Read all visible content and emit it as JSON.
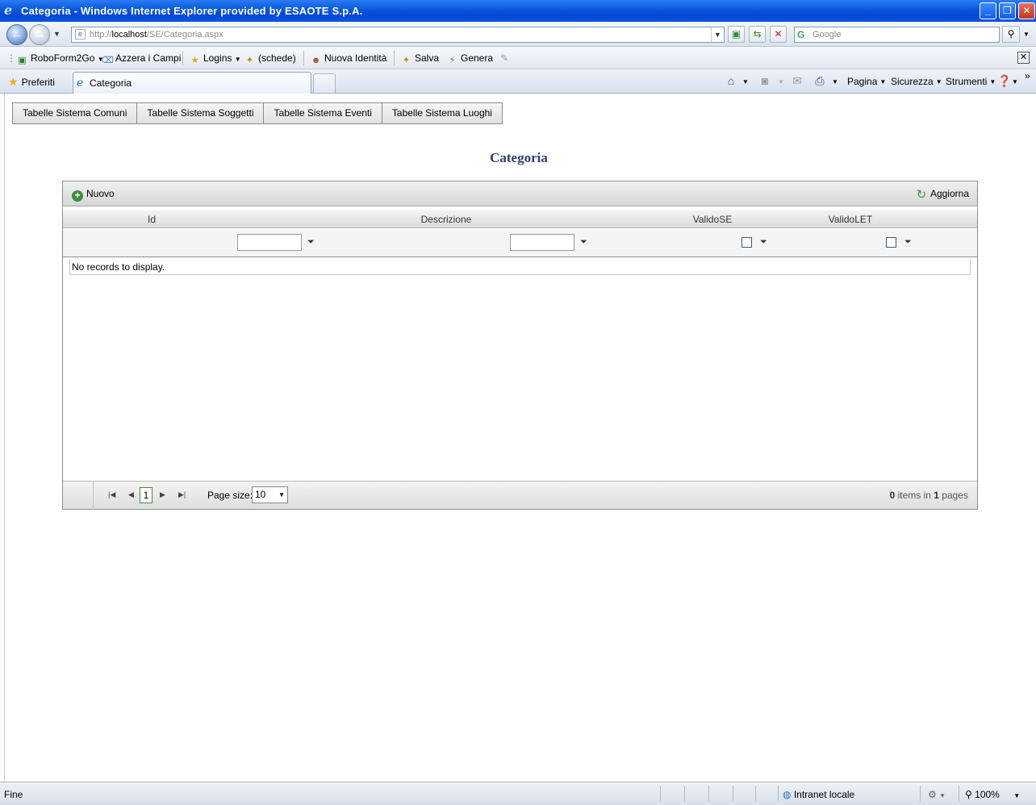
{
  "window": {
    "title": "Categoria - Windows Internet Explorer provided by ESAOTE S.p.A.",
    "min_glyph": "_",
    "max_glyph": "❐",
    "close_glyph": "✕"
  },
  "address": {
    "url_prefix": "http://",
    "url_host": "localhost",
    "url_path": "/SE/Categoria.aspx",
    "search_placeholder": "Google"
  },
  "links_toolbar": {
    "items": [
      {
        "label": "RoboForm2Go",
        "icon": "roboform-icon"
      },
      {
        "label": "Azzera i Campi",
        "icon": "eraser-icon"
      },
      {
        "label": "Logins",
        "icon": "star-icon"
      },
      {
        "label": "(schede)",
        "icon": "tabs-icon"
      },
      {
        "label": "Nuova Identità",
        "icon": "identity-icon"
      },
      {
        "label": "Salva",
        "icon": "save-icon"
      },
      {
        "label": "Genera",
        "icon": "generate-icon"
      }
    ]
  },
  "tabs": {
    "favorites_label": "Preferiti",
    "active_tab_label": "Categoria"
  },
  "command_bar": {
    "pagina": "Pagina",
    "sicurezza": "Sicurezza",
    "strumenti": "Strumenti"
  },
  "system_menu": [
    "Tabelle Sistema Comuni",
    "Tabelle Sistema Soggetti",
    "Tabelle Sistema Eventi",
    "Tabelle Sistema Luoghi"
  ],
  "page": {
    "title": "Categoria"
  },
  "grid": {
    "new_label": "Nuovo",
    "refresh_label": "Aggiorna",
    "columns": [
      "Id",
      "Descrizione",
      "ValidoSE",
      "ValidoLET"
    ],
    "empty_message": "No records to display.",
    "pager": {
      "current_page": "1",
      "page_size_label": "Page size:",
      "page_size_value": "10",
      "items_count": "0",
      "items_text": "items in",
      "pages_count": "1",
      "pages_text": "pages"
    }
  },
  "status_bar": {
    "left_text": "Fine",
    "zone_text": "Intranet locale",
    "zoom_text": "100%"
  },
  "colors": {
    "title_bar": "#0a5be0",
    "page_title": "#2c3e7a",
    "add_icon": "#3b8e3b"
  }
}
